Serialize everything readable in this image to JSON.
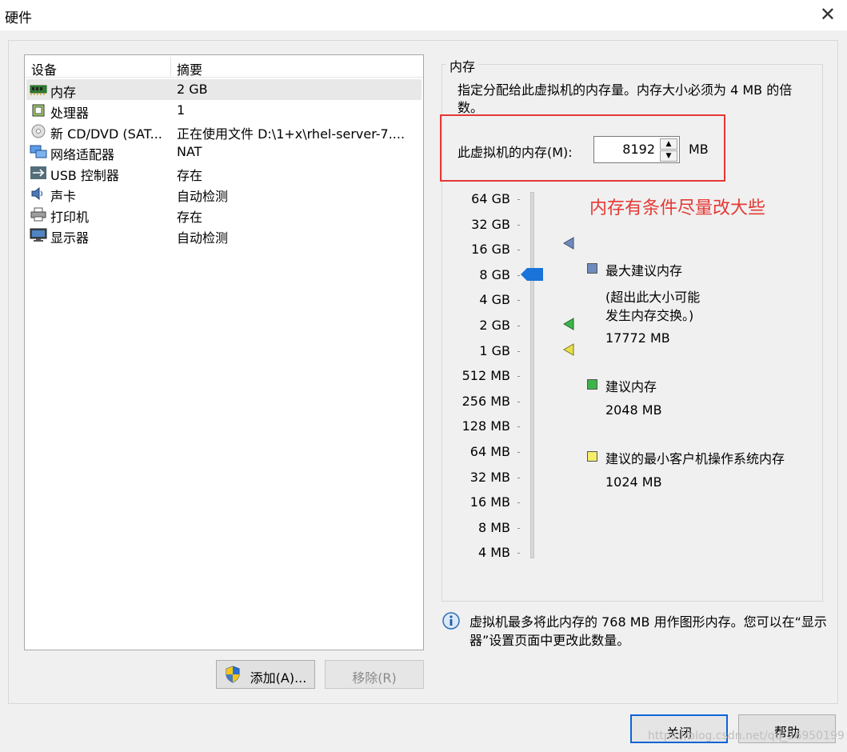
{
  "window": {
    "title": "硬件"
  },
  "device_list": {
    "header": {
      "device": "设备",
      "summary": "摘要"
    },
    "rows": [
      {
        "name": "内存",
        "summary": "2 GB",
        "icon": "memory-icon",
        "selected": true
      },
      {
        "name": "处理器",
        "summary": "1",
        "icon": "processor-icon"
      },
      {
        "name": "新 CD/DVD (SAT...",
        "summary": "正在使用文件 D:\\1+x\\rhel-server-7....",
        "icon": "cd-dvd-icon"
      },
      {
        "name": "网络适配器",
        "summary": "NAT",
        "icon": "network-adapter-icon"
      },
      {
        "name": "USB 控制器",
        "summary": "存在",
        "icon": "usb-icon"
      },
      {
        "name": "声卡",
        "summary": "自动检测",
        "icon": "sound-card-icon"
      },
      {
        "name": "打印机",
        "summary": "存在",
        "icon": "printer-icon"
      },
      {
        "name": "显示器",
        "summary": "自动检测",
        "icon": "display-icon"
      }
    ],
    "add_button": "添加(A)...",
    "remove_button": "移除(R)"
  },
  "memory": {
    "group_label": "内存",
    "description": "指定分配给此虚拟机的内存量。内存大小必须为 4 MB 的倍数。",
    "field_label": "此虚拟机的内存(M):",
    "field_value": "8192",
    "unit": "MB",
    "annotation": "内存有条件尽量改大些",
    "scale": [
      "64 GB",
      "32 GB",
      "16 GB",
      "8 GB",
      "4 GB",
      "2 GB",
      "1 GB",
      "512 MB",
      "256 MB",
      "128 MB",
      "64 MB",
      "32 MB",
      "16 MB",
      "8 MB",
      "4 MB"
    ],
    "slider_value": "8 GB",
    "legend": {
      "max": {
        "label": "最大建议内存",
        "note_line1": "(超出此大小可能",
        "note_line2": "发生内存交换。)",
        "value": "17772 MB"
      },
      "recommended": {
        "label": "建议内存",
        "value": "2048 MB"
      },
      "minimum": {
        "label": "建议的最小客户机操作系统内存",
        "value": "1024 MB"
      }
    },
    "info": "虚拟机最多将此内存的 768 MB 用作图形内存。您可以在“显示器”设置页面中更改此数量。"
  },
  "footer": {
    "close_button": "关闭",
    "help_button": "帮助"
  },
  "watermark": "https://blog.csdn.net/qq_26950199",
  "colors": {
    "annotation_red": "#e53935",
    "slider_blue": "#1a73d9",
    "max_marker": "#6f8bbd",
    "recommended_marker": "#3cb44a",
    "minimum_marker": "#e8e04a"
  }
}
